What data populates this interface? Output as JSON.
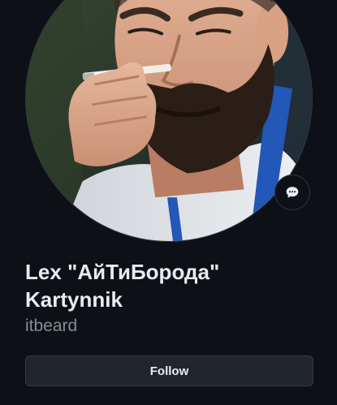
{
  "profile": {
    "name_line1": "Lex \"АйТиБорода\"",
    "name_line2": "Kartynnik",
    "username": "itbeard",
    "avatar_alt": "View itbeard's full-sized avatar",
    "status_icon": "speech-bubble-icon",
    "follow_label": "Follow"
  },
  "colors": {
    "background": "#0d1117",
    "text_primary": "#e6edf3",
    "text_muted": "#848d97",
    "button_bg": "#21262d",
    "border": "#30363d"
  }
}
